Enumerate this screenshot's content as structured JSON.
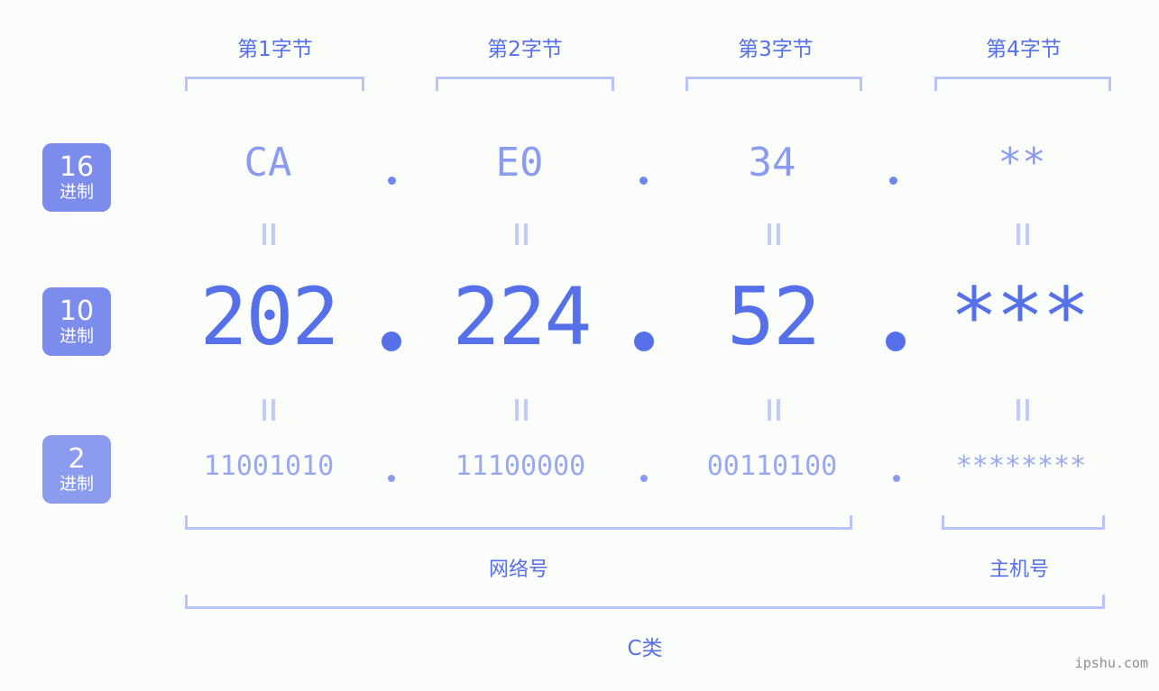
{
  "watermark": "ipshu.com",
  "bases": [
    {
      "num": "16",
      "unit": "进制"
    },
    {
      "num": "10",
      "unit": "进制"
    },
    {
      "num": "2",
      "unit": "进制"
    }
  ],
  "byte_headers": [
    {
      "label": "第1字节"
    },
    {
      "label": "第2字节"
    },
    {
      "label": "第3字节"
    },
    {
      "label": "第4字节"
    }
  ],
  "rows": {
    "hex": {
      "values": [
        "CA",
        "E0",
        "34",
        "**"
      ]
    },
    "dec": {
      "values": [
        "202",
        "224",
        "52",
        "***"
      ]
    },
    "bin": {
      "values": [
        "11001010",
        "11100000",
        "00110100",
        "********"
      ]
    }
  },
  "separators": {
    "dot": ".",
    "equals": "="
  },
  "sections": [
    {
      "label": "网络号"
    },
    {
      "label": "主机号"
    }
  ],
  "ip_class": {
    "label": "C类"
  },
  "colors": {
    "background": "#fbfdfa",
    "accent": "#5570e8",
    "accent_light": "#8b9cf0",
    "bracket": "#b9c3fa",
    "badge": "#7b8cec",
    "badge_light": "#8b9cef",
    "watermark": "#8d8d8d"
  }
}
